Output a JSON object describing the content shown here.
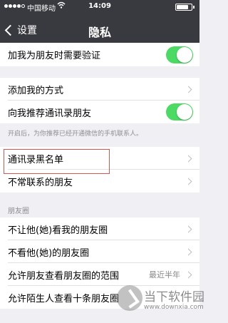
{
  "status_bar": {
    "carrier": "中国移动",
    "time": "14:09",
    "signal_bars_filled": 4,
    "signal_bars_total": 5,
    "battery_level": 0.8
  },
  "nav": {
    "back_label": "设置",
    "title": "隐私"
  },
  "rows": {
    "verify_add_friend": {
      "label": "加我为朋友时需要验证",
      "toggle_on": true
    },
    "add_me_methods": {
      "label": "添加我的方式"
    },
    "recommend_contacts": {
      "label": "向我推荐通讯录朋友",
      "toggle_on": true
    },
    "recommend_note": "开启后，为你推荐已经开通微信的手机联系人。",
    "contact_blacklist": {
      "label": "通讯录黑名单"
    },
    "infrequent_friends": {
      "label": "不常联系的朋友"
    },
    "moments_section_title": "朋友圈",
    "hide_my_moments": {
      "label": "不让他(她)看我的朋友圈"
    },
    "dont_see_their_moments": {
      "label": "不看他(她)的朋友圈"
    },
    "moments_visible_range": {
      "label": "允许朋友查看朋友圈的范围",
      "value": "最近半年"
    },
    "strangers_view_ten": {
      "label": "允许陌生人查看十条朋友圈"
    }
  },
  "watermark": {
    "title": "当下软件园",
    "url": "www.downxia.com"
  },
  "colors": {
    "nav_background": "#393a3f",
    "page_background": "#efeff4",
    "toggle_on": "#4cd964",
    "highlight_border": "#d9534f"
  }
}
